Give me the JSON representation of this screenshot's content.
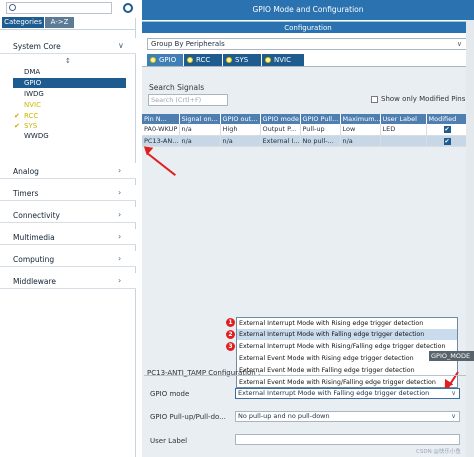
{
  "left": {
    "tabs": [
      "Categories",
      "A->Z"
    ],
    "categories": [
      {
        "label": "System Core"
      },
      {
        "label": "Analog"
      },
      {
        "label": "Timers"
      },
      {
        "label": "Connectivity"
      },
      {
        "label": "Multimedia"
      },
      {
        "label": "Computing"
      },
      {
        "label": "Middleware"
      }
    ],
    "sort_glyph": "↕",
    "system_core_items": [
      "DMA",
      "GPIO",
      "IWDG",
      "NVIC",
      "RCC",
      "SYS",
      "WWDG"
    ],
    "checked_mark": "✔"
  },
  "right": {
    "title": "GPIO Mode and Configuration",
    "subtitle": "Configuration",
    "group_by": "Group By Peripherals",
    "peripheral_tabs": [
      "GPIO",
      "RCC",
      "SYS",
      "NVIC"
    ],
    "search_label": "Search Signals",
    "search_placeholder": "Search (Crtl+F)",
    "show_modified_label": "Show only Modified Pins",
    "table": {
      "headers": [
        "Pin N...",
        "Signal on...",
        "GPIO out...",
        "GPIO mode",
        "GPIO Pull...",
        "Maximum...",
        "User Label",
        "Modified"
      ],
      "rows": [
        [
          "PA0-WKUP",
          "n/a",
          "High",
          "Output P...",
          "Pull-up",
          "Low",
          "LED",
          "✔"
        ],
        [
          "PC13-AN...",
          "n/a",
          "n/a",
          "External I...",
          "No pull-...",
          "n/a",
          "",
          "✔"
        ]
      ]
    },
    "dropdown_options": [
      "External Interrupt Mode with Rising edge trigger detection",
      "External Interrupt Mode with Falling edge trigger detection",
      "External Interrupt Mode with Rising/Falling edge trigger detection",
      "External Event Mode with Rising edge trigger detection",
      "External Event Mode with Falling edge trigger detection",
      "External Event Mode with Rising/Falling edge trigger detection"
    ],
    "badges": [
      "1",
      "2",
      "3"
    ],
    "tooltip": "GPIO_MODE",
    "config_title": "PC13-ANTI_TAMP Configuration :",
    "form": {
      "gpio_mode_label": "GPIO mode",
      "gpio_mode_value": "External Interrupt Mode with Falling edge trigger detection",
      "gpio_pull_label": "GPIO Pull-up/Pull-do...",
      "gpio_pull_value": "No pull-up and no pull-down",
      "user_label_label": "User Label",
      "user_label_value": ""
    },
    "watermark": "CSDN @快乐小鱼"
  },
  "colors": {
    "accent": "#1e5b8f",
    "header": "#2a72b0",
    "annotation": "#e02020"
  }
}
